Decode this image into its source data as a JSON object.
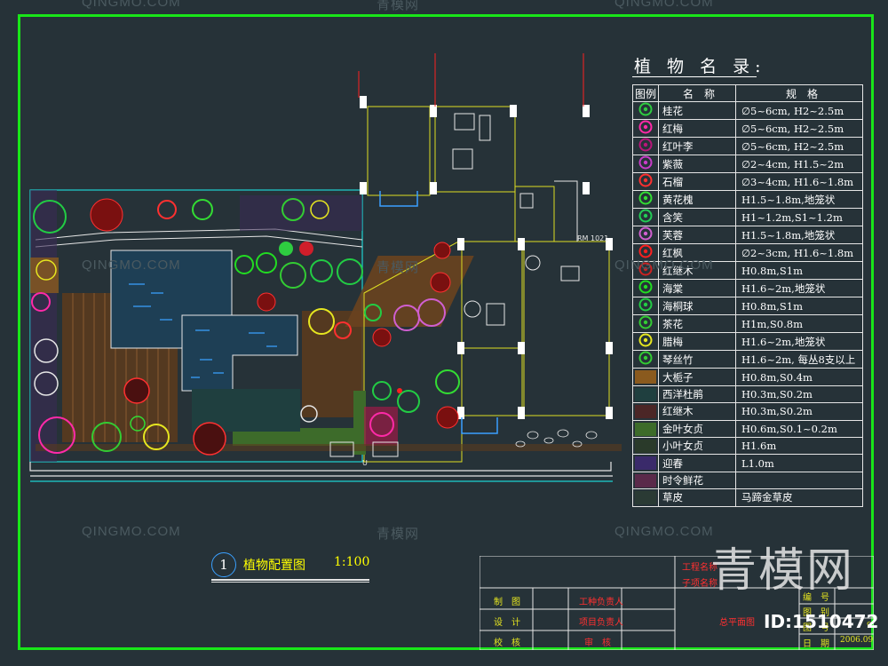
{
  "legend": {
    "title": "植 物 名 录:",
    "headers": {
      "symbol": "图例",
      "name": "名　称",
      "spec": "规　格"
    },
    "rows": [
      {
        "name": "桂花",
        "spec": "∅5~6cm, H2~2.5m",
        "icon": "osmanthus-icon",
        "color": "#2ecc40"
      },
      {
        "name": "红梅",
        "spec": "∅5~6cm, H2~2.5m",
        "icon": "red-plum-icon",
        "color": "#ff2aa8"
      },
      {
        "name": "红叶李",
        "spec": "∅5~6cm, H2~2.5m",
        "icon": "purple-leaf-plum-icon",
        "color": "#b8157a"
      },
      {
        "name": "紫薇",
        "spec": "∅2~4cm, H1.5~2m",
        "icon": "crape-myrtle-icon",
        "color": "#c83cc8"
      },
      {
        "name": "石榴",
        "spec": "∅3~4cm, H1.6~1.8m",
        "icon": "pomegranate-icon",
        "color": "#ff3030"
      },
      {
        "name": "黄花槐",
        "spec": "H1.5~1.8m,地笼状",
        "icon": "yellow-sophora-icon",
        "color": "#33dd33"
      },
      {
        "name": "含笑",
        "spec": "H1~1.2m,S1~1.2m",
        "icon": "michelia-icon",
        "color": "#22cc55"
      },
      {
        "name": "芙蓉",
        "spec": "H1.5~1.8m,地笼状",
        "icon": "hibiscus-icon",
        "color": "#d05fd0"
      },
      {
        "name": "红枫",
        "spec": "∅2~3cm, H1.6~1.8m",
        "icon": "red-maple-icon",
        "color": "#ff2020"
      },
      {
        "name": "红继木",
        "spec": "H0.8m,S1m",
        "icon": "loropetalum-icon",
        "color": "#cc2222"
      },
      {
        "name": "海棠",
        "spec": "H1.6~2m,地笼状",
        "icon": "crabapple-icon",
        "color": "#22dd22"
      },
      {
        "name": "海桐球",
        "spec": "H0.8m,S1m",
        "icon": "pittosporum-icon",
        "color": "#22cc44"
      },
      {
        "name": "茶花",
        "spec": "H1m,S0.8m",
        "icon": "camellia-icon",
        "color": "#33cc33"
      },
      {
        "name": "腊梅",
        "spec": "H1.6~2m,地笼状",
        "icon": "wintersweet-icon",
        "color": "#e6e620"
      },
      {
        "name": "琴丝竹",
        "spec": "H1.6~2m, 每丛8支以上",
        "icon": "bamboo-icon",
        "color": "#33cc33"
      },
      {
        "name": "大栀子",
        "spec": "H0.8m,S0.4m",
        "icon": "gardenia-swatch",
        "color": "#8a5a1e"
      },
      {
        "name": "西洋杜鹃",
        "spec": "H0.3m,S0.2m",
        "icon": "azalea-swatch",
        "color": "#1f3f3f"
      },
      {
        "name": "红继木",
        "spec": "H0.3m,S0.2m",
        "icon": "loropetalum-swatch",
        "color": "#4b2626"
      },
      {
        "name": "金叶女贞",
        "spec": "H0.6m,S0.1~0.2m",
        "icon": "golden-privet-swatch",
        "color": "#3d6b2a"
      },
      {
        "name": "小叶女贞",
        "spec": "H1.6m",
        "icon": "privet-swatch",
        "color": "#2a3a2a"
      },
      {
        "name": "迎春",
        "spec": "L1.0m",
        "icon": "winter-jasmine-swatch",
        "color": "#3a2a6a"
      },
      {
        "name": "时令鲜花",
        "spec": "",
        "icon": "seasonal-flowers-swatch",
        "color": "#5a2a4a"
      },
      {
        "name": "草皮",
        "spec": "马蹄金草皮",
        "icon": "lawn-swatch",
        "color": "#2a3a34"
      }
    ]
  },
  "plan_title": {
    "number": "1",
    "text": "植物配置图",
    "scale": "1:100"
  },
  "plan_labels": {
    "door_tag": "RM 1021",
    "mark_u": "U"
  },
  "title_block": {
    "rows": [
      {
        "label": "制　图",
        "role": "工种负责人"
      },
      {
        "label": "设　计",
        "role": "项目负责人"
      },
      {
        "label": "校　核",
        "role": "审　核"
      }
    ],
    "project_top": "工程名称",
    "project_sub": "子项名称",
    "drawing_name": "总平面图",
    "fields": [
      "编　号",
      "图　别",
      "图　号",
      "日　期"
    ],
    "date": "2006.09",
    "sheet": "9"
  },
  "watermark": {
    "text": "QINGMO.COM",
    "cn": "青模网",
    "big": "青模网",
    "id": "ID:1510472"
  }
}
